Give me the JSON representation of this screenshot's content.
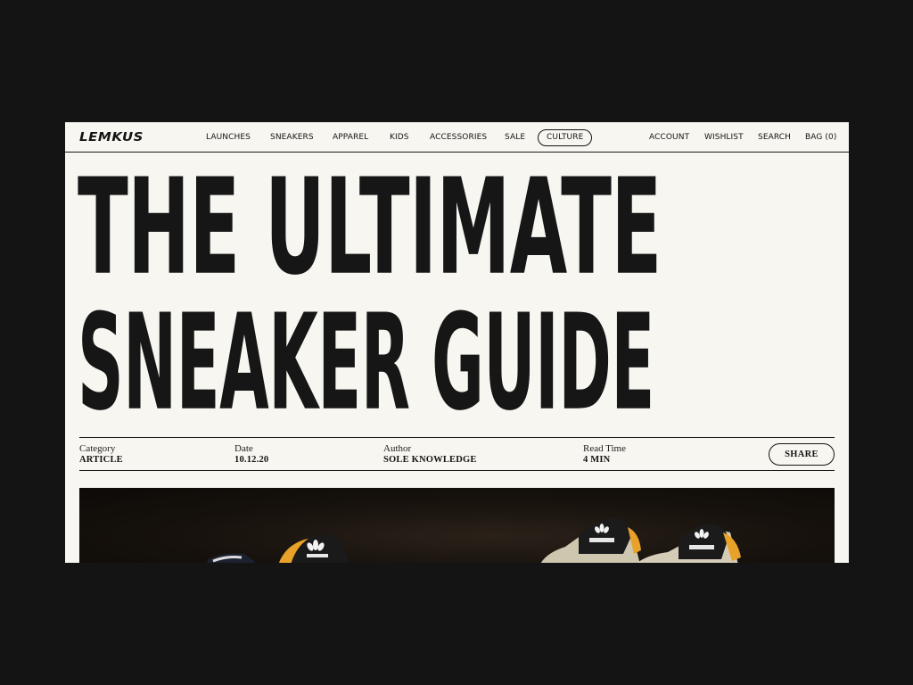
{
  "brand": {
    "logo_text": "LEMKUS"
  },
  "nav": {
    "primary": [
      {
        "label": "LAUNCHES"
      },
      {
        "label": "SNEAKERS"
      },
      {
        "label": "APPAREL"
      },
      {
        "label": "KIDS"
      },
      {
        "label": "ACCESSORIES"
      },
      {
        "label": "SALE"
      },
      {
        "label": "CULTURE",
        "active": true
      }
    ],
    "utility": [
      {
        "label": "ACCOUNT"
      },
      {
        "label": "WISHLIST"
      },
      {
        "label": "SEARCH"
      },
      {
        "label": "BAG (0)"
      }
    ]
  },
  "article": {
    "title_line1": "THE ULTIMATE",
    "title_line2": "SNEAKER GUIDE",
    "meta": {
      "category": {
        "label": "Category",
        "value": "ARTICLE"
      },
      "date": {
        "label": "Date",
        "value": "10.12.20"
      },
      "author": {
        "label": "Author",
        "value": "SOLE KNOWLEDGE"
      },
      "read_time": {
        "label": "Read Time",
        "value": "4 MIN"
      }
    },
    "share_label": "SHARE",
    "hero_image": {
      "subject": "adidas sneakers on dark background",
      "icons": [
        "adidas-trefoil-icon"
      ]
    }
  },
  "colors": {
    "page_background": "#141414",
    "frame_background": "#f7f6f0",
    "ink": "#141414",
    "accent_orange": "#e8a22a"
  }
}
